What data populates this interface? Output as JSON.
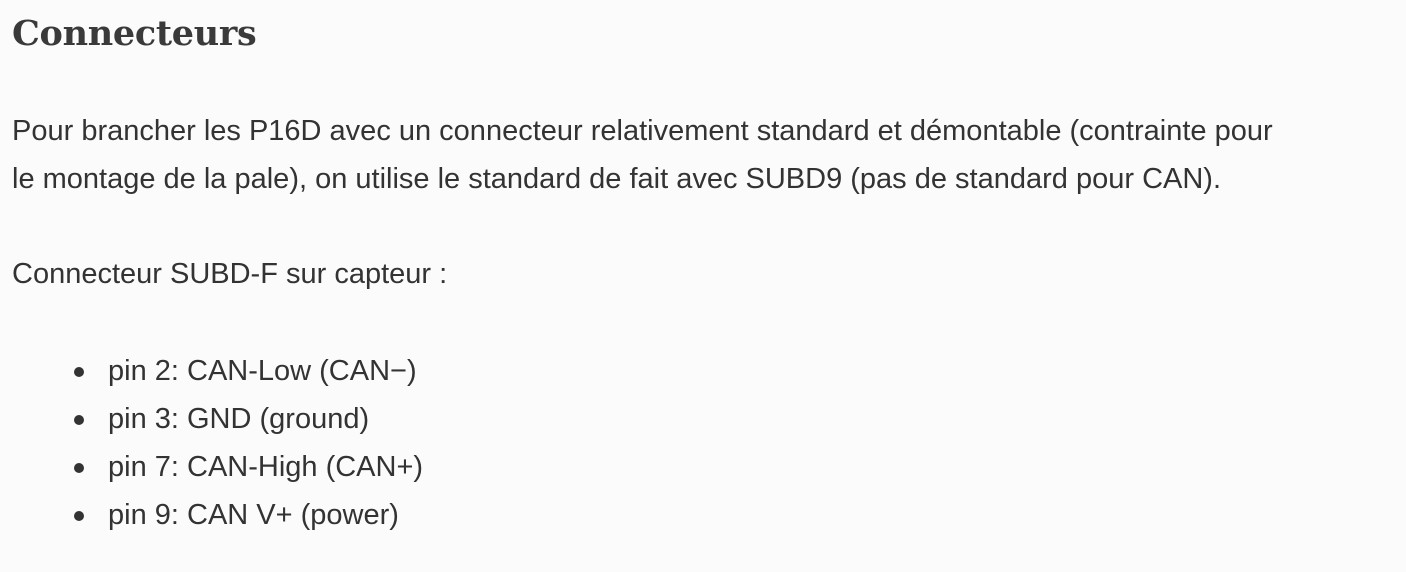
{
  "heading": "Connecteurs",
  "paragraph1_line1": "Pour brancher les P16D avec un connecteur relativement standard et démontable (contrainte pour",
  "paragraph1_line2": "le montage de la pale), on utilise le standard de fait avec SUBD9 (pas de standard pour CAN).",
  "paragraph2": "Connecteur SUBD-F sur capteur :",
  "pins": [
    "pin 2: CAN-Low (CAN−)",
    "pin 3: GND (ground)",
    "pin 7: CAN-High (CAN+)",
    "pin 9: CAN V+ (power)"
  ]
}
